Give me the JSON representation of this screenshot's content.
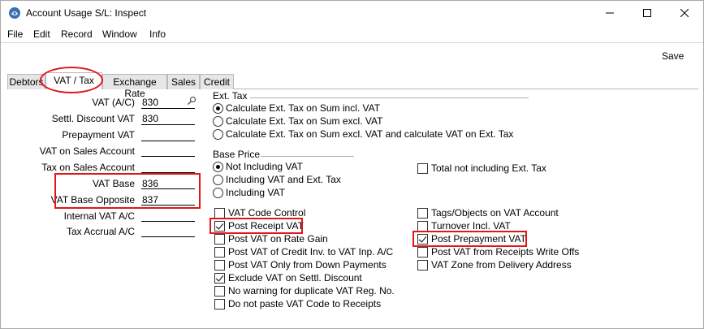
{
  "window": {
    "title": "Account Usage S/L: Inspect",
    "icon": "app-icon"
  },
  "menu": [
    "File",
    "Edit",
    "Record",
    "Window",
    "Info"
  ],
  "toolbar": {
    "save_label": "Save"
  },
  "tabs": [
    {
      "label": "Debtors",
      "active": false
    },
    {
      "label": "VAT / Tax",
      "active": true
    },
    {
      "label": "Exchange Rate",
      "active": false
    },
    {
      "label": "Sales",
      "active": false
    },
    {
      "label": "Credit",
      "active": false
    }
  ],
  "fields": [
    {
      "label": "VAT (A/C)",
      "value": "830"
    },
    {
      "label": "Settl. Discount VAT",
      "value": "830"
    },
    {
      "label": "Prepayment VAT",
      "value": ""
    },
    {
      "label": "VAT on Sales Account",
      "value": ""
    },
    {
      "label": "Tax on Sales Account",
      "value": ""
    },
    {
      "label": "VAT Base",
      "value": "836"
    },
    {
      "label": "VAT Base Opposite",
      "value": "837"
    },
    {
      "label": "Internal VAT A/C",
      "value": ""
    },
    {
      "label": "Tax Accrual A/C",
      "value": ""
    }
  ],
  "ext_tax": {
    "heading": "Ext. Tax",
    "options": [
      {
        "label": "Calculate Ext. Tax on Sum incl. VAT",
        "selected": true
      },
      {
        "label": "Calculate Ext. Tax on Sum excl. VAT",
        "selected": false
      },
      {
        "label": "Calculate Ext. Tax on Sum excl. VAT and calculate VAT on Ext. Tax",
        "selected": false
      }
    ]
  },
  "base_price": {
    "heading": "Base Price",
    "options": [
      {
        "label": "Not Including VAT",
        "selected": true
      },
      {
        "label": "Including VAT and Ext. Tax",
        "selected": false
      },
      {
        "label": "Including VAT",
        "selected": false
      }
    ],
    "total_not_incl": {
      "label": "Total not including Ext. Tax",
      "checked": false
    }
  },
  "checks_left": [
    {
      "label": "VAT Code Control",
      "checked": false
    },
    {
      "label": "Post Receipt VAT",
      "checked": true
    },
    {
      "label": "Post VAT on Rate Gain",
      "checked": false
    },
    {
      "label": "Post VAT of Credit Inv. to VAT Inp. A/C",
      "checked": false
    },
    {
      "label": "Post VAT Only from Down Payments",
      "checked": false
    },
    {
      "label": "Exclude VAT on Settl. Discount",
      "checked": true
    },
    {
      "label": "No warning for duplicate VAT Reg. No.",
      "checked": false
    },
    {
      "label": "Do not paste VAT Code to Receipts",
      "checked": false
    }
  ],
  "checks_right": [
    {
      "label": "Tags/Objects on VAT Account",
      "checked": false
    },
    {
      "label": "Turnover Incl. VAT",
      "checked": false
    },
    {
      "label": "Post Prepayment VAT",
      "checked": true
    },
    {
      "label": "Post VAT from Receipts Write Offs",
      "checked": false
    },
    {
      "label": "VAT Zone from Delivery Address",
      "checked": false
    }
  ],
  "colors": {
    "annotation": "#e0161b",
    "tab_inactive": "#e6e6e6"
  }
}
